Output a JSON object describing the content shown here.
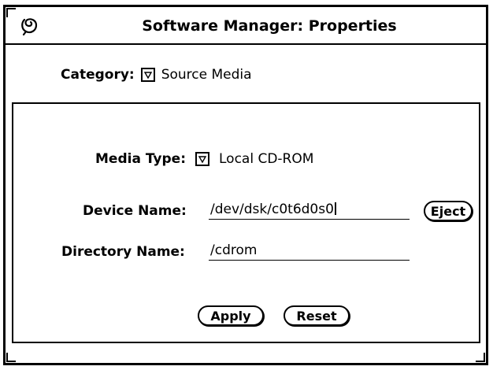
{
  "window": {
    "title": "Software Manager: Properties"
  },
  "category": {
    "label": "Category:",
    "value": "Source Media"
  },
  "media_type": {
    "label": "Media Type:",
    "value": "Local CD-ROM"
  },
  "device_name": {
    "label": "Device Name:",
    "value": "/dev/dsk/c0t6d0s0"
  },
  "directory_name": {
    "label": "Directory Name:",
    "value": "/cdrom"
  },
  "buttons": {
    "eject": "Eject",
    "apply": "Apply",
    "reset": "Reset"
  },
  "icons": {
    "window_menu": "window-menu-icon",
    "menu_button": "menu-triangle-icon"
  }
}
